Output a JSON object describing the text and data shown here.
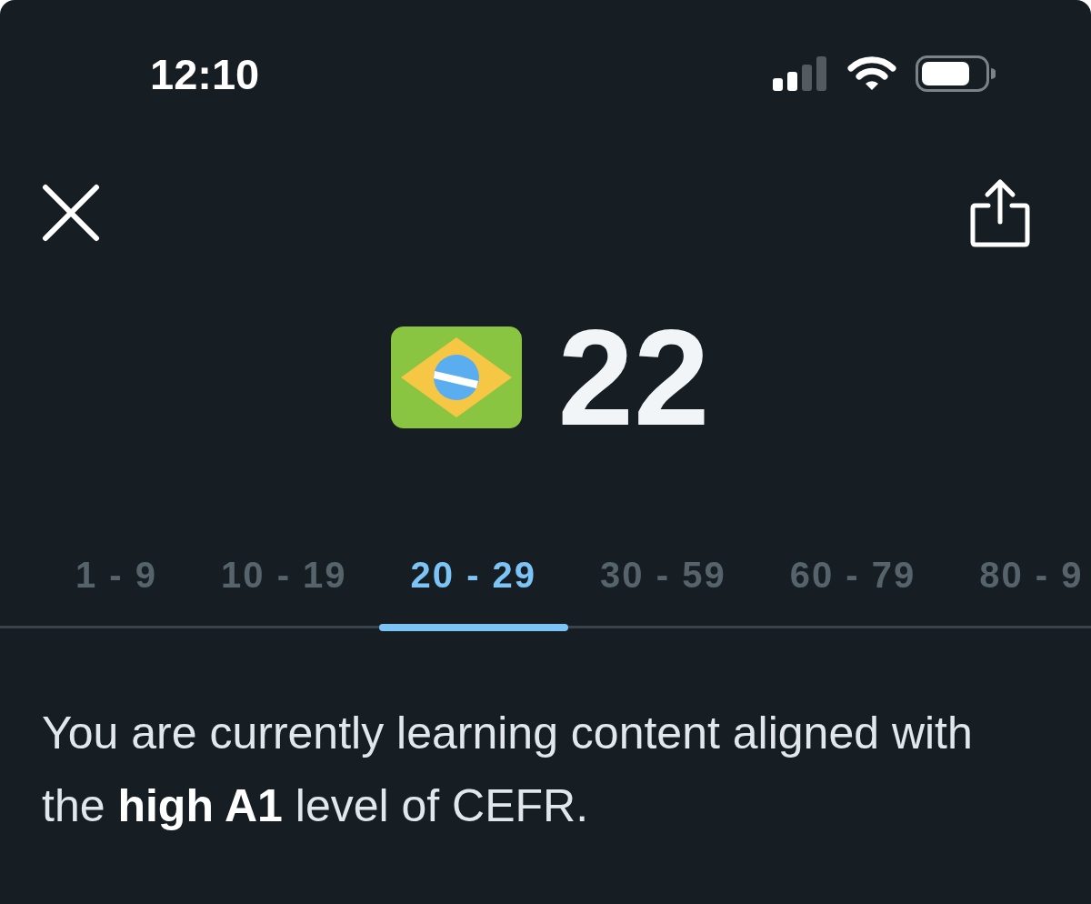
{
  "status_bar": {
    "time": "12:10"
  },
  "score": {
    "value": "22"
  },
  "tabs": [
    {
      "label": "1 - 9",
      "selected": false
    },
    {
      "label": "10 - 19",
      "selected": false
    },
    {
      "label": "20 - 29",
      "selected": true
    },
    {
      "label": "30 - 59",
      "selected": false
    },
    {
      "label": "60 - 79",
      "selected": false
    },
    {
      "label": "80 - 9",
      "selected": false
    }
  ],
  "description": "You are currently learning content aligned with the **high A1** level of CEFR."
}
